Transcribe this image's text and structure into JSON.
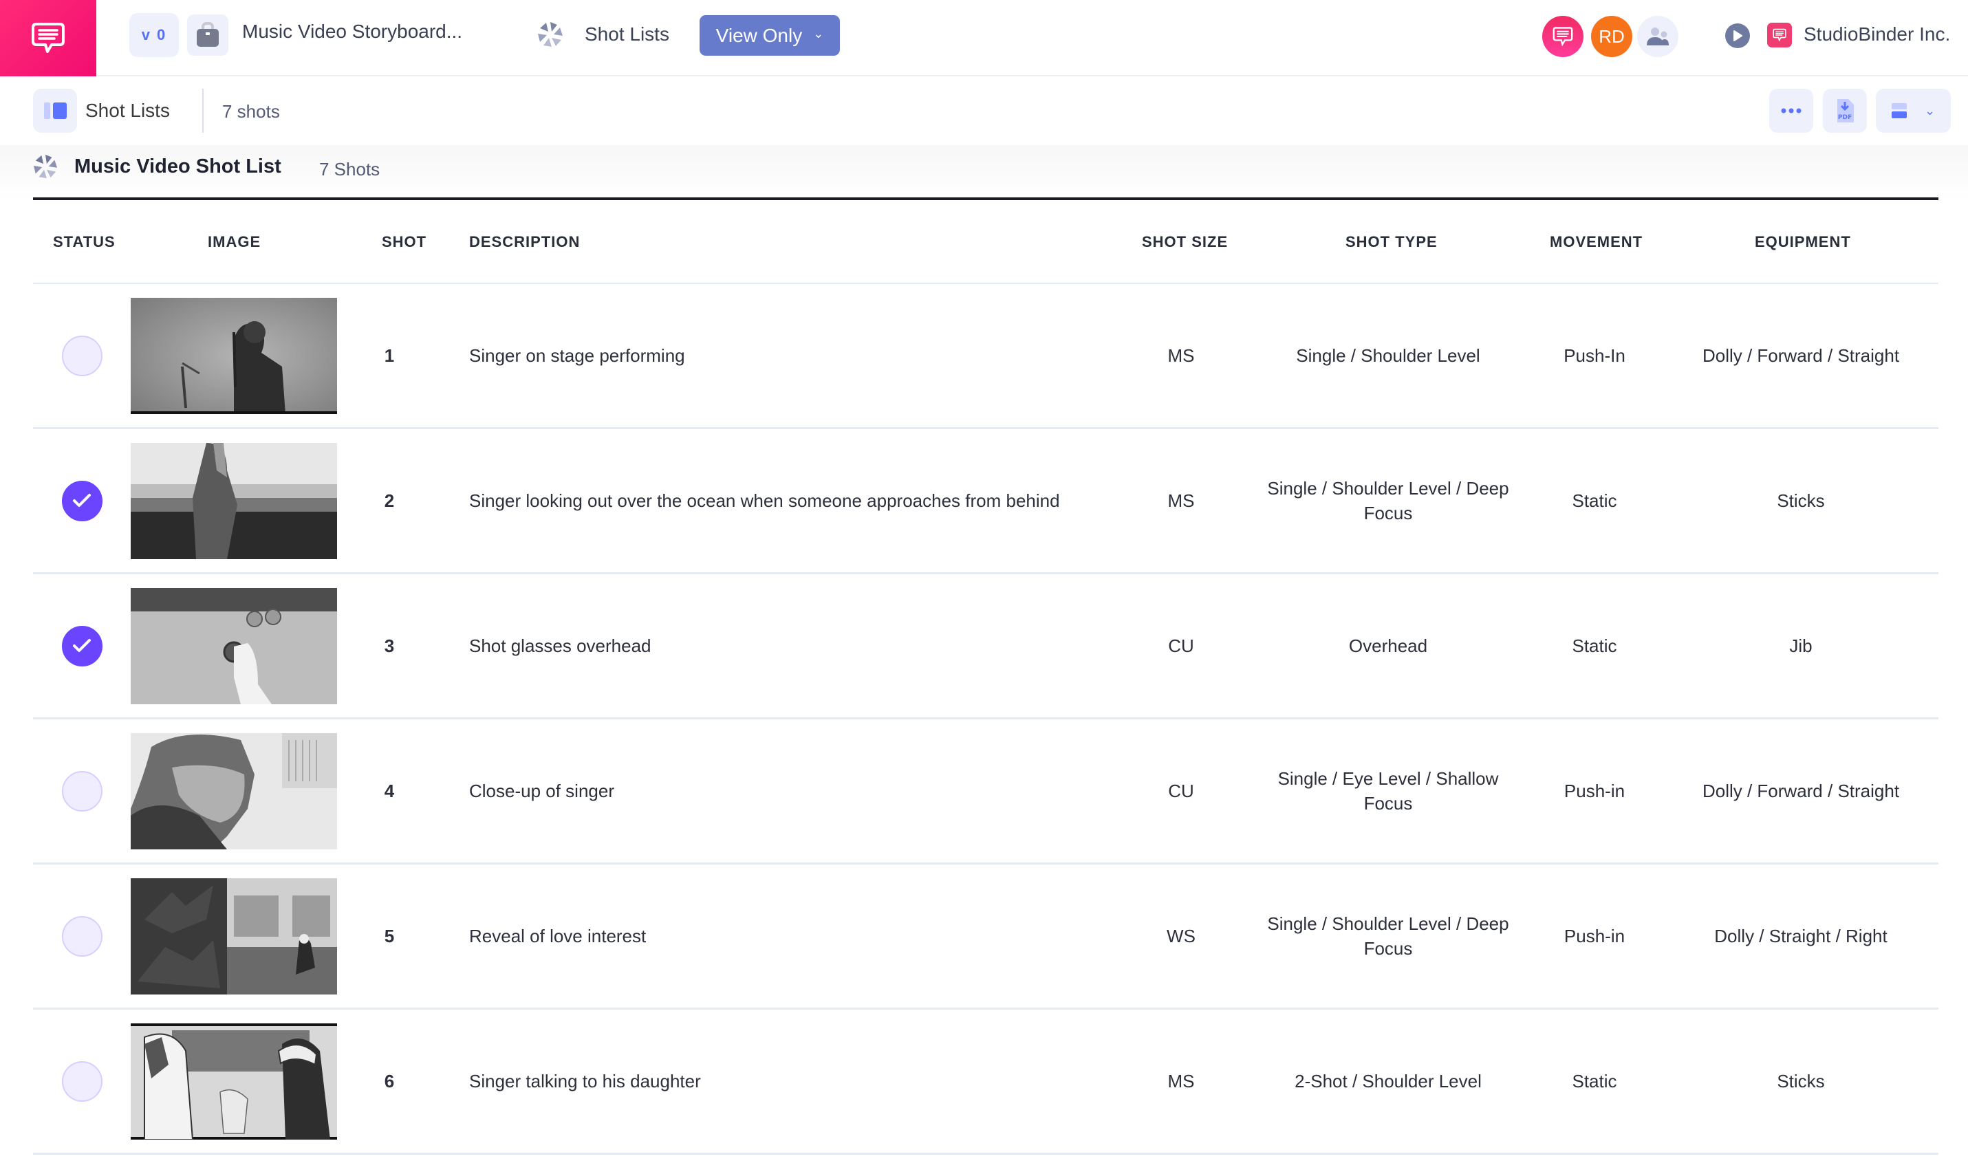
{
  "topbar": {
    "version_label": "v 0",
    "project_title": "Music Video Storyboard...",
    "nav_label": "Shot Lists",
    "view_mode_label": "View Only",
    "avatar_initials": "RD",
    "company_name": "StudioBinder Inc.",
    "brand_color": "#f20d70",
    "accent_color": "#677bcc"
  },
  "subbar": {
    "tab_label": "Shot Lists",
    "shot_count": "7 shots",
    "tools": {
      "more": "more-icon",
      "pdf": "PDF",
      "view": "layout-icon"
    }
  },
  "list": {
    "title": "Music Video Shot List",
    "count": "7 Shots"
  },
  "table": {
    "headers": {
      "status": "STATUS",
      "image": "IMAGE",
      "shot": "SHOT",
      "description": "DESCRIPTION",
      "shot_size": "SHOT SIZE",
      "shot_type": "SHOT TYPE",
      "movement": "MOVEMENT",
      "equipment": "EQUIPMENT"
    },
    "rows": [
      {
        "done": false,
        "image": "singer-on-stage-sketch",
        "shot": "1",
        "description": "Singer on stage performing",
        "shot_size": "MS",
        "shot_type": "Single / Shoulder Level",
        "movement": "Push-In",
        "equipment": "Dolly / Forward / Straight"
      },
      {
        "done": true,
        "image": "singer-ocean-sketch",
        "shot": "2",
        "description": "Singer looking out over the ocean when someone approaches from behind",
        "shot_size": "MS",
        "shot_type": "Single / Shoulder Level / Deep Focus",
        "movement": "Static",
        "equipment": "Sticks"
      },
      {
        "done": true,
        "image": "shot-glasses-overhead-sketch",
        "shot": "3",
        "description": "Shot glasses overhead",
        "shot_size": "CU",
        "shot_type": "Overhead",
        "movement": "Static",
        "equipment": "Jib"
      },
      {
        "done": false,
        "image": "singer-closeup-sketch",
        "shot": "4",
        "description": "Close-up of singer",
        "shot_size": "CU",
        "shot_type": "Single / Eye Level / Shallow Focus",
        "movement": "Push-in",
        "equipment": "Dolly / Forward / Straight"
      },
      {
        "done": false,
        "image": "love-interest-reveal-sketch",
        "shot": "5",
        "description": "Reveal of love interest",
        "shot_size": "WS",
        "shot_type": "Single / Shoulder Level / Deep Focus",
        "movement": "Push-in",
        "equipment": "Dolly / Straight / Right"
      },
      {
        "done": false,
        "image": "singer-daughter-sketch",
        "shot": "6",
        "description": "Singer talking to his daughter",
        "shot_size": "MS",
        "shot_type": "2-Shot / Shoulder Level",
        "movement": "Static",
        "equipment": "Sticks"
      }
    ]
  }
}
